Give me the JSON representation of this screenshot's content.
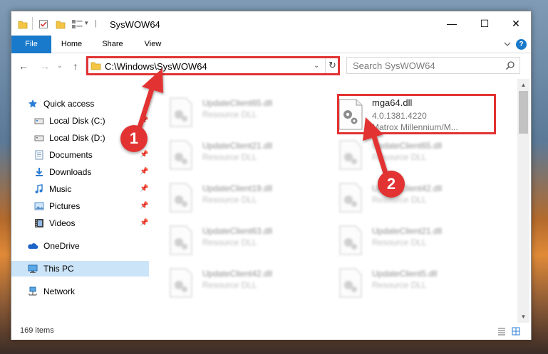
{
  "window": {
    "title": "SysWOW64",
    "controls": {
      "minimize": "—",
      "maximize": "☐",
      "close": "✕"
    }
  },
  "ribbon": {
    "tabs": [
      "File",
      "Home",
      "Share",
      "View"
    ],
    "help": "?"
  },
  "navigation": {
    "back": "←",
    "forward": "→",
    "recent": "⌄",
    "up": "↑"
  },
  "address_bar": {
    "path": "C:\\Windows\\SysWOW64",
    "dropdown": "⌄",
    "refresh": "↻"
  },
  "search": {
    "placeholder": "Search SysWOW64"
  },
  "nav_pane": {
    "items": [
      {
        "label": "Quick access",
        "icon": "star-icon",
        "pinned": false
      },
      {
        "label": "Local Disk (C:)",
        "icon": "drive-icon",
        "pinned": true
      },
      {
        "label": "Local Disk (D:)",
        "icon": "drive-icon",
        "pinned": false
      },
      {
        "label": "Documents",
        "icon": "documents-icon",
        "pinned": true
      },
      {
        "label": "Downloads",
        "icon": "downloads-icon",
        "pinned": true
      },
      {
        "label": "Music",
        "icon": "music-icon",
        "pinned": true
      },
      {
        "label": "Pictures",
        "icon": "pictures-icon",
        "pinned": true
      },
      {
        "label": "Videos",
        "icon": "videos-icon",
        "pinned": true
      },
      {
        "label": "OneDrive",
        "icon": "onedrive-icon",
        "pinned": false
      },
      {
        "label": "This PC",
        "icon": "this-pc-icon",
        "pinned": false,
        "selected": true
      },
      {
        "label": "Network",
        "icon": "network-icon",
        "pinned": false
      }
    ]
  },
  "files": {
    "left_column": [
      {
        "name": "UpdateClient65.dll",
        "type": "Resource DLL"
      },
      {
        "name": "UpdateClient21.dll",
        "type": "Resource DLL"
      },
      {
        "name": "UpdateClient19.dll",
        "type": "Resource DLL"
      },
      {
        "name": "UpdateClient63.dll",
        "type": "Resource DLL"
      },
      {
        "name": "UpdateClient42.dll",
        "type": "Resource DLL"
      }
    ],
    "right_column": [
      {
        "name": "UpdateClient65.dll",
        "type": "Resource DLL"
      },
      {
        "name": "UpdateClient42.dll",
        "type": "Resource DLL"
      },
      {
        "name": "UpdateClient21.dll",
        "type": "Resource DLL"
      },
      {
        "name": "UpdateClient5.dll",
        "type": "Resource DLL"
      }
    ],
    "highlighted": {
      "name": "mga64.dll",
      "version": "4.0.1381.4220",
      "description": "Matrox Millennium/M..."
    }
  },
  "status_bar": {
    "item_count": "169 items"
  },
  "annotations": {
    "step1": "1",
    "step2": "2",
    "color": "#e23232"
  },
  "colors": {
    "accent": "#1979ca",
    "selection": "#cce4f7",
    "annotation": "#e23232"
  }
}
